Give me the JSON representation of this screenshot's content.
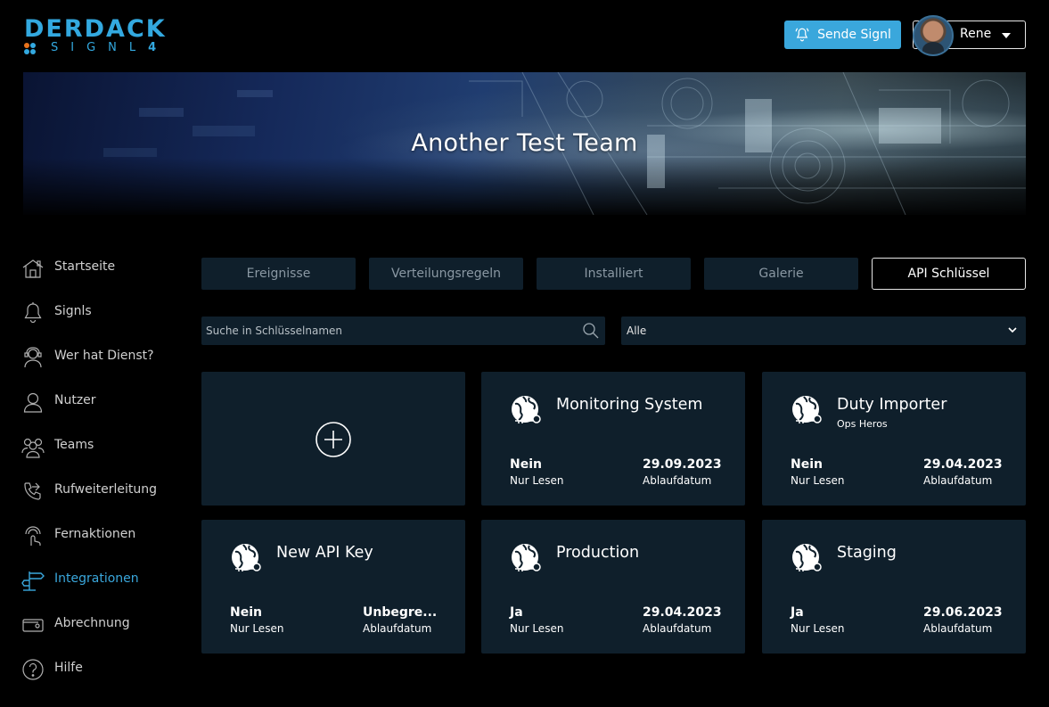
{
  "brand": {
    "word": "DERDACK",
    "sub_letters": "SIGNL",
    "sub_number": "4",
    "accent_color": "#33a9e0"
  },
  "header": {
    "send_button_label": "Sende Signl",
    "user_name": "Rene"
  },
  "banner": {
    "title": "Another Test Team"
  },
  "sidebar": {
    "items": [
      {
        "label": "Startseite",
        "icon": "home-icon"
      },
      {
        "label": "Signls",
        "icon": "bell-icon"
      },
      {
        "label": "Wer hat Dienst?",
        "icon": "on-duty-icon"
      },
      {
        "label": "Nutzer",
        "icon": "user-icon"
      },
      {
        "label": "Teams",
        "icon": "teams-icon"
      },
      {
        "label": "Rufweiterleitung",
        "icon": "call-forward-icon"
      },
      {
        "label": "Fernaktionen",
        "icon": "remote-action-icon"
      },
      {
        "label": "Integrationen",
        "icon": "integrations-icon",
        "active": true
      },
      {
        "label": "Abrechnung",
        "icon": "billing-icon"
      },
      {
        "label": "Hilfe",
        "icon": "help-icon"
      }
    ]
  },
  "tabs": [
    {
      "label": "Ereignisse"
    },
    {
      "label": "Verteilungsregeln"
    },
    {
      "label": "Installiert"
    },
    {
      "label": "Galerie"
    },
    {
      "label": "API Schlüssel",
      "active": true
    }
  ],
  "filters": {
    "search_placeholder": "Suche in Schlüsselnamen",
    "search_value": "",
    "select_value": "Alle"
  },
  "cards": [
    {
      "title": "Monitoring System",
      "subtitle": "",
      "readonly_value": "Nein",
      "readonly_label": "Nur Lesen",
      "expiry_value": "29.09.2023",
      "expiry_label": "Ablaufdatum"
    },
    {
      "title": "Duty Importer",
      "subtitle": "Ops Heros",
      "readonly_value": "Nein",
      "readonly_label": "Nur Lesen",
      "expiry_value": "29.04.2023",
      "expiry_label": "Ablaufdatum"
    },
    {
      "title": "New API Key",
      "subtitle": "",
      "readonly_value": "Nein",
      "readonly_label": "Nur Lesen",
      "expiry_value": "Unbegre...",
      "expiry_label": "Ablaufdatum"
    },
    {
      "title": "Production",
      "subtitle": "",
      "readonly_value": "Ja",
      "readonly_label": "Nur Lesen",
      "expiry_value": "29.04.2023",
      "expiry_label": "Ablaufdatum"
    },
    {
      "title": "Staging",
      "subtitle": "",
      "readonly_value": "Ja",
      "readonly_label": "Nur Lesen",
      "expiry_value": "29.06.2023",
      "expiry_label": "Ablaufdatum"
    }
  ],
  "colors": {
    "background": "#000000",
    "panel": "#0f1f2b",
    "accent": "#3aa7dc",
    "muted_text": "#8a98a3"
  }
}
